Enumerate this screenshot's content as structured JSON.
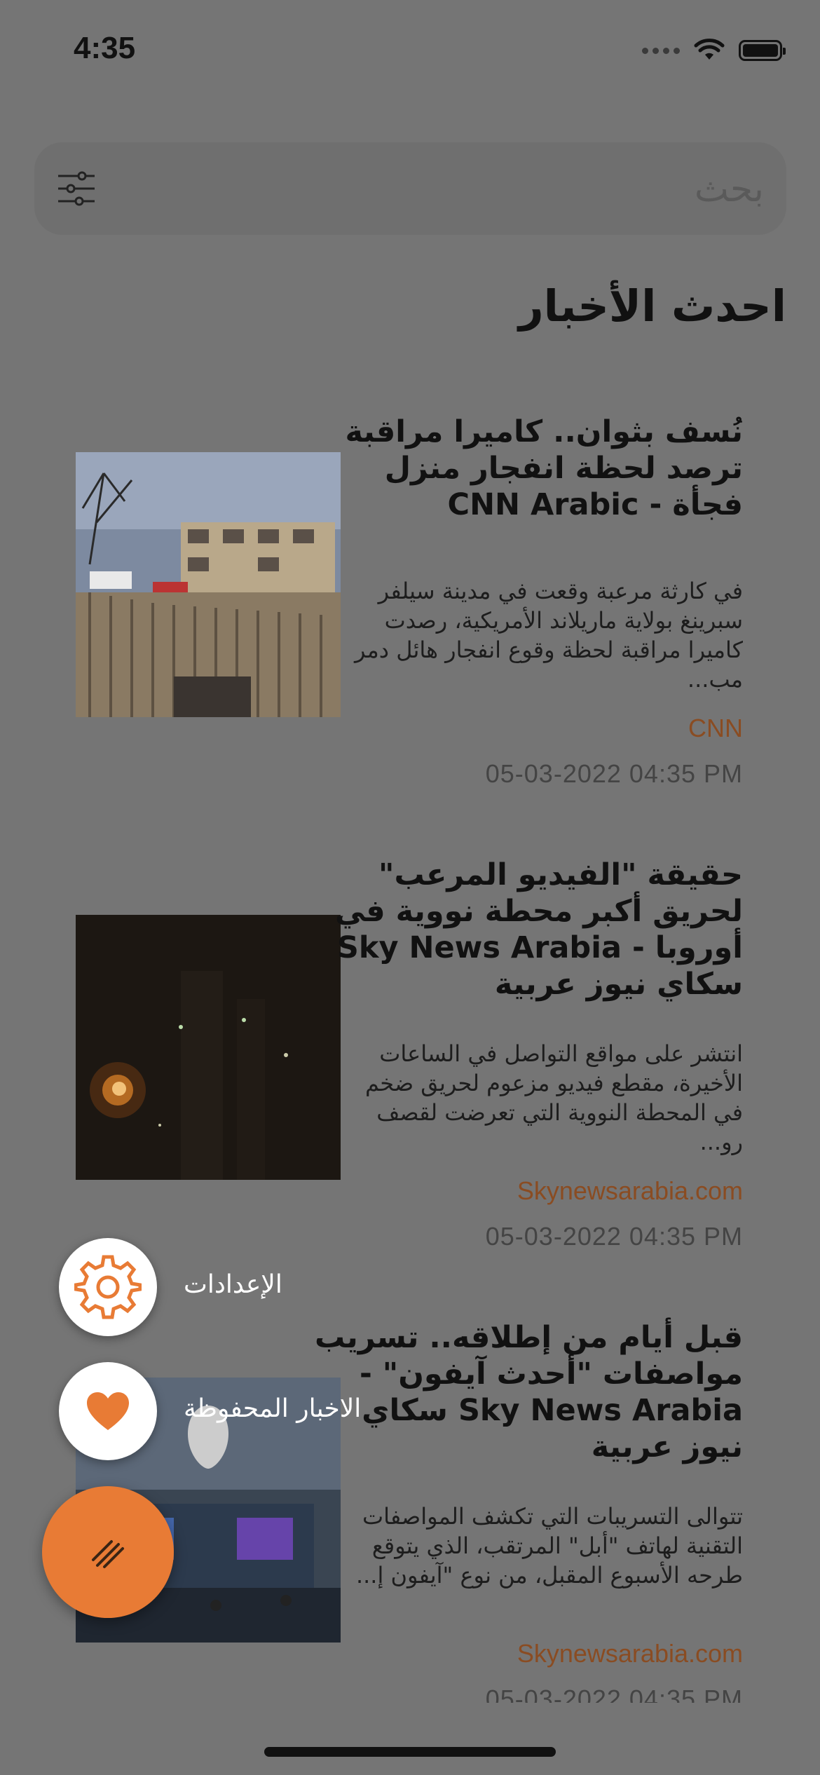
{
  "status_bar": {
    "time": "4:35"
  },
  "search": {
    "placeholder": "بحث"
  },
  "page_title": "احدث الأخبار",
  "articles": [
    {
      "title": "نُسف بثوان.. كاميرا مراقبة ترصد لحظة انفجار منزل فجأة - CNN Arabic",
      "description": "في كارثة مرعبة وقعت في مدينة سيلفر سبرينغ بولاية ماريلاند الأمريكية، رصدت كاميرا مراقبة لحظة وقوع انفجار هائل دمر مب...",
      "source": "CNN",
      "date": "05-03-2022 04:35 PM"
    },
    {
      "title": "حقيقة \"الفيديو المرعب\" لحريق أكبر محطة نووية في أوروبا - Sky News Arabia سكاي نيوز عربية",
      "description": "انتشر على مواقع التواصل في الساعات الأخيرة، مقطع فيديو مزعوم لحريق ضخم في المحطة النووية التي تعرضت لقصف رو...",
      "source": "Skynewsarabia.com",
      "date": "05-03-2022 04:35 PM"
    },
    {
      "title": "قبل أيام من إطلاقه.. تسريب مواصفات \"أحدث آيفون\" - Sky News Arabia سكاي نيوز عربية",
      "description": "تتوالى التسريبات التي تكشف المواصفات التقنية لهاتف \"أبل\" المرتقب، الذي يتوقع طرحه الأسبوع المقبل، من نوع \"آيفون إ...",
      "source": "Skynewsarabia.com",
      "date": "05-03-2022 04:35 PM"
    }
  ],
  "fab_menu": {
    "settings_label": "الإعدادات",
    "saved_label": "الاخبار المحفوظة"
  },
  "colors": {
    "accent": "#e87b35",
    "source_text": "#8a4c22"
  }
}
